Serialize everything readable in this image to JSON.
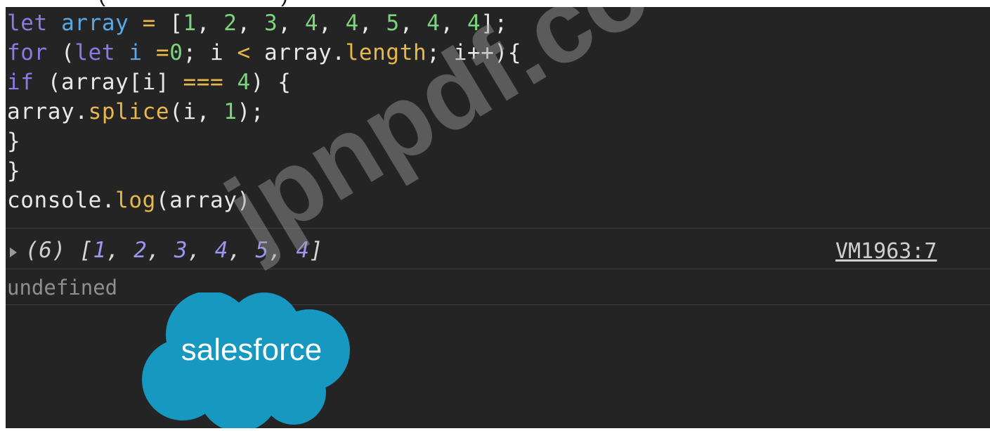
{
  "caption": "(                              )",
  "code_lines": [
    {
      "tokens": [
        {
          "t": "let ",
          "c": "kw"
        },
        {
          "t": "array",
          "c": "var"
        },
        {
          "t": " = ",
          "c": "op"
        },
        {
          "t": "[",
          "c": "plain"
        },
        {
          "t": "1",
          "c": "num"
        },
        {
          "t": ", ",
          "c": "plain"
        },
        {
          "t": "2",
          "c": "num"
        },
        {
          "t": ", ",
          "c": "plain"
        },
        {
          "t": "3",
          "c": "num"
        },
        {
          "t": ", ",
          "c": "plain"
        },
        {
          "t": "4",
          "c": "num"
        },
        {
          "t": ", ",
          "c": "plain"
        },
        {
          "t": "4",
          "c": "num"
        },
        {
          "t": ", ",
          "c": "plain"
        },
        {
          "t": "5",
          "c": "num"
        },
        {
          "t": ", ",
          "c": "plain"
        },
        {
          "t": "4",
          "c": "num"
        },
        {
          "t": ", ",
          "c": "plain"
        },
        {
          "t": "4",
          "c": "num"
        },
        {
          "t": "];",
          "c": "plain"
        }
      ]
    },
    {
      "tokens": [
        {
          "t": "for",
          "c": "kw"
        },
        {
          "t": " (",
          "c": "plain"
        },
        {
          "t": "let",
          "c": "kw"
        },
        {
          "t": " ",
          "c": "plain"
        },
        {
          "t": "i",
          "c": "var"
        },
        {
          "t": " =",
          "c": "op"
        },
        {
          "t": "0",
          "c": "num"
        },
        {
          "t": "; i ",
          "c": "plain"
        },
        {
          "t": "<",
          "c": "op"
        },
        {
          "t": " array.",
          "c": "plain"
        },
        {
          "t": "length",
          "c": "fn"
        },
        {
          "t": "; i++){",
          "c": "plain"
        }
      ]
    },
    {
      "tokens": [
        {
          "t": "if",
          "c": "kw"
        },
        {
          "t": " (array[i] ",
          "c": "plain"
        },
        {
          "t": "===",
          "c": "op"
        },
        {
          "t": " ",
          "c": "plain"
        },
        {
          "t": "4",
          "c": "num"
        },
        {
          "t": ") {",
          "c": "plain"
        }
      ]
    },
    {
      "tokens": [
        {
          "t": "array.",
          "c": "plain"
        },
        {
          "t": "splice",
          "c": "fn"
        },
        {
          "t": "(i, ",
          "c": "plain"
        },
        {
          "t": "1",
          "c": "num"
        },
        {
          "t": ");",
          "c": "plain"
        }
      ]
    },
    {
      "tokens": [
        {
          "t": "}",
          "c": "plain"
        }
      ]
    },
    {
      "tokens": [
        {
          "t": "}",
          "c": "plain"
        }
      ]
    },
    {
      "tokens": [
        {
          "t": "console.",
          "c": "plain"
        },
        {
          "t": "log",
          "c": "fn"
        },
        {
          "t": "(array)",
          "c": "plain"
        }
      ]
    }
  ],
  "output": {
    "count": "(6) ",
    "open_bracket": "[",
    "values": [
      "1",
      "2",
      "3",
      "4",
      "5",
      "4"
    ],
    "separator": ", ",
    "close_bracket": "]",
    "source": "VM1963:7"
  },
  "return_value": "undefined",
  "watermark": "jpnpdf.com",
  "logo_text": "salesforce",
  "colors": {
    "console_bg": "#242424",
    "keyword": "#8a7be0",
    "variable": "#5aa9e6",
    "operator": "#e8b84b",
    "number": "#7cd47c",
    "output_number": "#9d95f0",
    "logo_blue": "#1798c1"
  },
  "icons": {
    "expand": "triangle-right-icon",
    "logo": "salesforce-cloud-logo"
  }
}
